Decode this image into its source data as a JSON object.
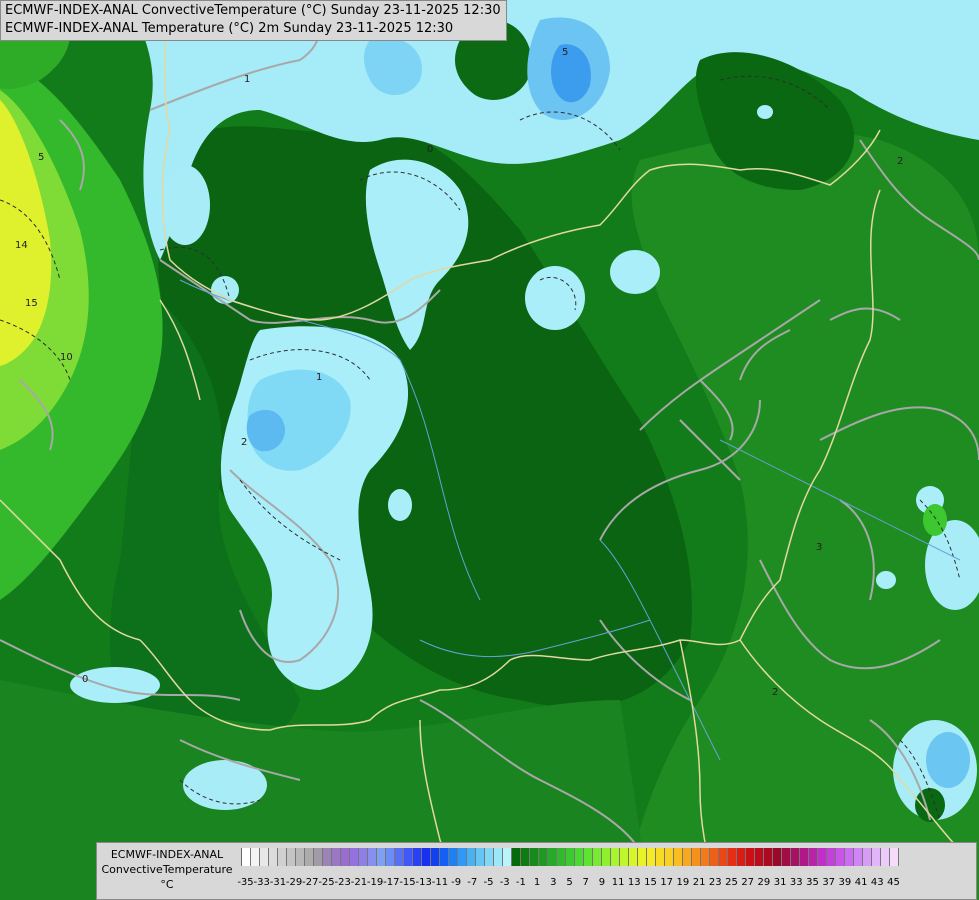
{
  "header": {
    "line1": "ECMWF-INDEX-ANAL ConvectiveTemperature (°C) Sunday 23-11-2025 12:30",
    "line2": "ECMWF-INDEX-ANAL Temperature (°C) 2m Sunday 23-11-2025 12:30"
  },
  "legend": {
    "title_line1": "ECMWF-INDEX-ANAL",
    "title_line2": "ConvectiveTemperature",
    "unit": "°C",
    "tick_labels": [
      "-35",
      "-33",
      "-31",
      "-29",
      "-27",
      "-25",
      "-23",
      "-21",
      "-19",
      "-17",
      "-15",
      "-13",
      "-11",
      "-9",
      "-7",
      "-5",
      "-3",
      "-1",
      "1",
      "3",
      "5",
      "7",
      "9",
      "11",
      "13",
      "15",
      "17",
      "19",
      "21",
      "23",
      "25",
      "27",
      "29",
      "31",
      "33",
      "35",
      "37",
      "39",
      "41",
      "43",
      "45"
    ],
    "colors": [
      "#ffffff",
      "#f4f4f4",
      "#e8e8e8",
      "#dcdcdc",
      "#d0d0d0",
      "#c4c4c4",
      "#b8b8b8",
      "#acacac",
      "#a39aa8",
      "#9c84b8",
      "#9a78c4",
      "#9a6cd2",
      "#9470e0",
      "#8c80e8",
      "#8690ee",
      "#7ea0f2",
      "#6c8cf6",
      "#5870f8",
      "#4058f8",
      "#2840f6",
      "#1830f0",
      "#1040f0",
      "#1460f4",
      "#1e80f6",
      "#3098f6",
      "#48b0f4",
      "#64c6f4",
      "#80d8f6",
      "#9ce8f8",
      "#b8f4fa",
      "#066a0a",
      "#0e7a12",
      "#168a1a",
      "#1e9a22",
      "#26aa28",
      "#30ba2c",
      "#3cca30",
      "#4cd832",
      "#60e232",
      "#78ea30",
      "#90f030",
      "#a8f42e",
      "#c0f62c",
      "#d6f62a",
      "#e8f228",
      "#f4ea26",
      "#f8dc24",
      "#fad022",
      "#fabe20",
      "#f8a81e",
      "#f6921c",
      "#f27a1a",
      "#ee6018",
      "#ea4616",
      "#e62e14",
      "#dc1c14",
      "#cc1018",
      "#bc0c1c",
      "#ac0a22",
      "#9c0828",
      "#a00c44",
      "#a81064",
      "#b01888",
      "#b824a8",
      "#c030c8",
      "#c440dc",
      "#c854ea",
      "#cc6cf2",
      "#d084f6",
      "#d89cf8",
      "#e2b4fa",
      "#eccafa",
      "#f4dcfa"
    ]
  },
  "map": {
    "colors": {
      "dark_green": "#0a6c12",
      "mid_green": "#16881a",
      "green": "#2a9a24",
      "bright_green": "#3cc82e",
      "lime": "#9ee63a",
      "yellow": "#e6f02c",
      "light_blue": "#aaeefa",
      "mid_blue": "#6cc6f2",
      "blue": "#3c9cee",
      "border": "#e2d8a0",
      "contour": "#a8a8a8",
      "dashed": "#303030",
      "river": "#6aa0d8"
    },
    "contour_labels": [
      "1",
      "0",
      "2",
      "2",
      "3",
      "5",
      "14",
      "15",
      "10",
      "5",
      "1",
      "0",
      "2"
    ]
  }
}
